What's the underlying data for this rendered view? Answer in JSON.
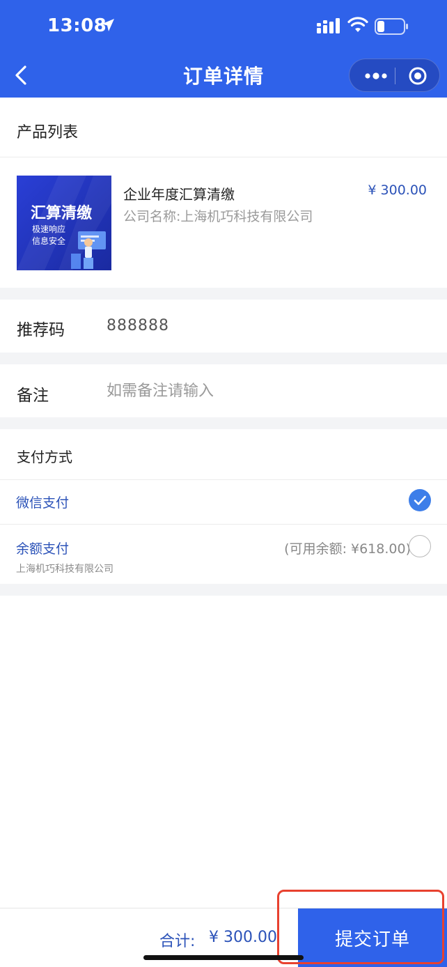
{
  "status_bar": {
    "time": "13:08"
  },
  "nav": {
    "title": "订单详情"
  },
  "products": {
    "section_title": "产品列表",
    "items": [
      {
        "name": "企业年度汇算清缴",
        "company": "公司名称:上海机巧科技有限公司",
        "price": "¥ 300.00",
        "thumb": {
          "headline": "汇算清缴",
          "line1": "极速响应",
          "line2": "信息安全"
        }
      }
    ]
  },
  "referral": {
    "label": "推荐码",
    "value": "888888"
  },
  "remark": {
    "label": "备注",
    "placeholder": "如需备注请输入"
  },
  "payment": {
    "section_title": "支付方式",
    "options": [
      {
        "label": "微信支付",
        "selected": true
      },
      {
        "label": "余额支付",
        "sub": "上海机巧科技有限公司",
        "balance": "(可用余额: ¥618.00)",
        "selected": false
      }
    ]
  },
  "footer": {
    "total_label": "合计:",
    "total_value": "¥ 300.00",
    "submit_label": "提交订单"
  },
  "colors": {
    "brand": "#2f62ea",
    "accent_text": "#2b52b8",
    "highlight": "#e8412f"
  }
}
